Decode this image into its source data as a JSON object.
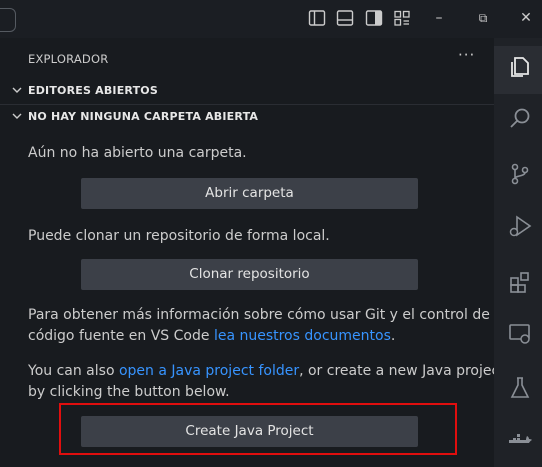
{
  "sidebar": {
    "title": "EXPLORADOR",
    "more_label": "···",
    "sections": [
      {
        "label": "EDITORES ABIERTOS"
      },
      {
        "label": "NO HAY NINGUNA CARPETA ABIERTA"
      }
    ],
    "no_folder_text": "Aún no ha abierto una carpeta.",
    "open_folder_label": "Abrir carpeta",
    "clone_text": "Puede clonar un repositorio de forma local.",
    "clone_label": "Clonar repositorio",
    "git_info_line1": "Para obtener más información sobre cómo usar Git y el control de",
    "git_info_line2_pre": "código fuente en VS Code ",
    "git_docs_link": "lea nuestros documentos",
    "git_info_line2_post": ".",
    "java_line1_pre": "You can also ",
    "java_link": "open a Java project folder",
    "java_line1_post": ", or create a new Java project",
    "java_line2": "by clicking the button below.",
    "create_java_label": "Create Java Project"
  },
  "window_controls": {
    "minimize": "–",
    "restore": "⧉",
    "close": "✕"
  },
  "colors": {
    "background": "#181b1f",
    "button": "#3c4048",
    "link": "#3794ff",
    "highlight": "#e00e0e"
  }
}
